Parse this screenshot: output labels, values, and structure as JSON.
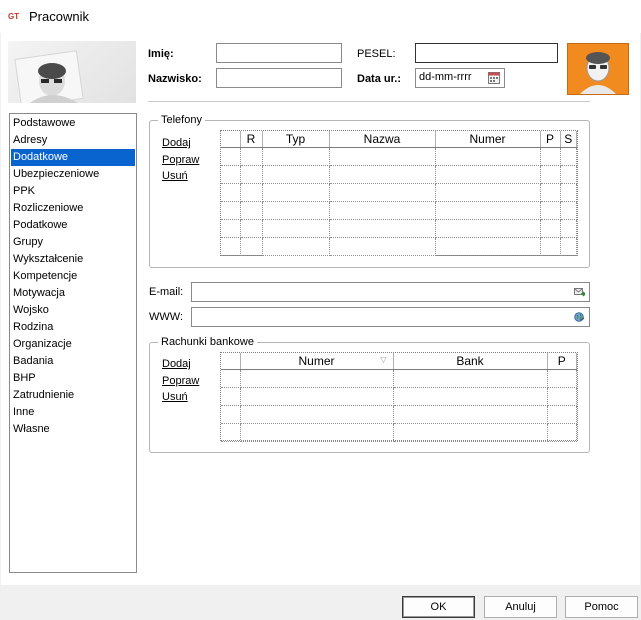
{
  "window": {
    "title": "Pracownik",
    "logo_text": "GT"
  },
  "form": {
    "imie_label": "Imię:",
    "nazwisko_label": "Nazwisko:",
    "pesel_label": "PESEL:",
    "data_label": "Data ur.:",
    "imie_value": "",
    "nazwisko_value": "",
    "pesel_value": "",
    "data_placeholder": "dd-mm-rrrr"
  },
  "sidebar": {
    "items": [
      {
        "label": "Podstawowe"
      },
      {
        "label": "Adresy"
      },
      {
        "label": "Dodatkowe",
        "selected": true
      },
      {
        "label": "Ubezpieczeniowe"
      },
      {
        "label": "PPK"
      },
      {
        "label": "Rozliczeniowe"
      },
      {
        "label": "Podatkowe"
      },
      {
        "label": "Grupy"
      },
      {
        "label": "Wykształcenie"
      },
      {
        "label": "Kompetencje"
      },
      {
        "label": "Motywacja"
      },
      {
        "label": "Wojsko"
      },
      {
        "label": "Rodzina"
      },
      {
        "label": "Organizacje"
      },
      {
        "label": "Badania"
      },
      {
        "label": "BHP"
      },
      {
        "label": "Zatrudnienie"
      },
      {
        "label": "Inne"
      },
      {
        "label": "Własne"
      }
    ]
  },
  "telefony": {
    "title": "Telefony",
    "actions": {
      "add": "Dodaj",
      "edit": "Popraw",
      "delete": "Usuń"
    },
    "columns": [
      "",
      "R",
      "Typ",
      "Nazwa",
      "Numer",
      "P",
      "S"
    ]
  },
  "email": {
    "label": "E-mail:",
    "value": ""
  },
  "www": {
    "label": "WWW:",
    "value": ""
  },
  "rachunki": {
    "title": "Rachunki bankowe",
    "actions": {
      "add": "Dodaj",
      "edit": "Popraw",
      "delete": "Usuń"
    },
    "columns": [
      "",
      "Numer",
      "Bank",
      "P"
    ]
  },
  "buttons": {
    "ok": "OK",
    "cancel": "Anuluj",
    "help": "Pomoc"
  },
  "colors": {
    "selection": "#0a64d0",
    "avatar": "#f28b1f"
  }
}
